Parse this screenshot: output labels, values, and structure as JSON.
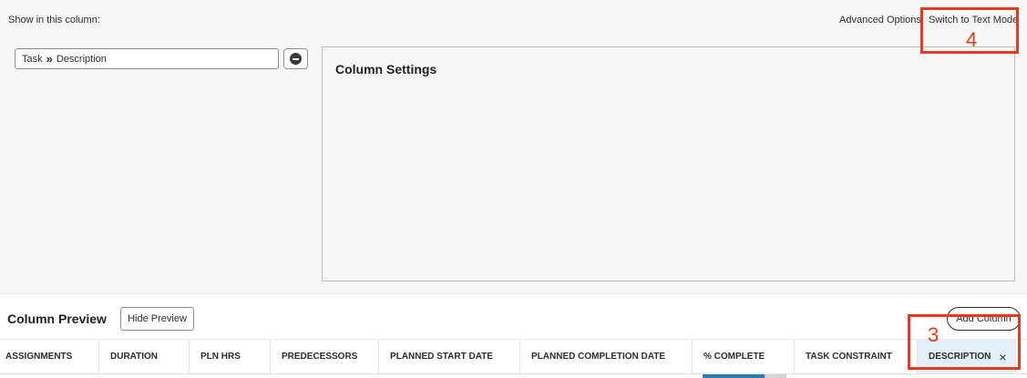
{
  "header": {
    "show_label": "Show in this column:",
    "advanced_options": "Advanced Options",
    "switch_text_mode": "Switch to Text Mode"
  },
  "field": {
    "part1": "Task",
    "separator": "»",
    "part2": "Description"
  },
  "settings": {
    "title": "Column Settings"
  },
  "preview": {
    "title": "Column Preview",
    "hide_button": "Hide Preview",
    "add_button": "Add Column"
  },
  "columns": [
    "ASSIGNMENTS",
    "DURATION",
    "PLN HRS",
    "PREDECESSORS",
    "PLANNED START DATE",
    "PLANNED COMPLETION DATE",
    "% COMPLETE",
    "TASK CONSTRAINT",
    "DESCRIPTION"
  ],
  "close_symbol": "×",
  "annotations": {
    "a4": "4",
    "a3": "3"
  },
  "colors": {
    "annotation": "#e33b20",
    "selected_column": "#e1f0fb",
    "progress": "#2a7ab5"
  }
}
